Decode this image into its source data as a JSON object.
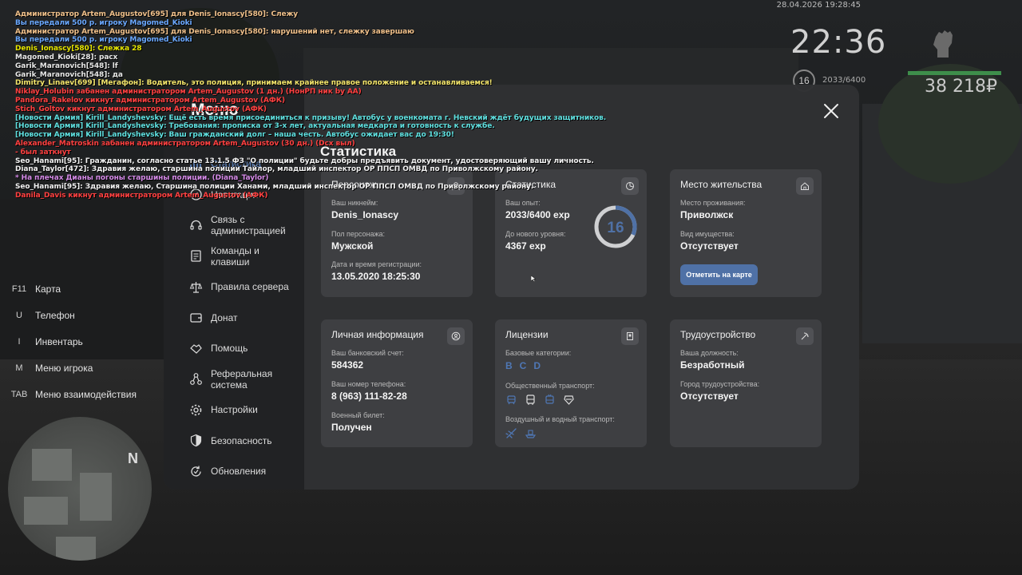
{
  "hud": {
    "datetime": "28.04.2026 19:28:45",
    "time": "22:36",
    "level": "16",
    "exp": "2033/6400",
    "money": "38 218₽"
  },
  "chat": [
    {
      "text": "Администратор Artem_Augustov[695] для Denis_Ionascy[580]: Слежу",
      "color": "#f0c08a"
    },
    {
      "text": "Вы передали 500 р. игроку Magomed_Kioki",
      "color": "#6aa8ff"
    },
    {
      "text": "Администратор Artem_Augustov[695] для Denis_Ionascy[580]: нарушений нет, слежку завершаю",
      "color": "#f0c08a"
    },
    {
      "text": "Вы передали 500 р. игроку Magomed_Kioki",
      "color": "#6aa8ff"
    },
    {
      "text": "Denis_Ionascy[580]: Слежка 28",
      "color": "#e6e600",
      "name": "Denis_Ionascy[580]",
      "nameColor": "#8fd67a"
    },
    {
      "text": "Magomed_Kioki[28]: расх",
      "color": "#e8e8e8"
    },
    {
      "text": "Garik_Maranovich[548]: lf",
      "color": "#e8e8e8"
    },
    {
      "text": "Garik_Maranovich[548]: да",
      "color": "#e8e8e8"
    },
    {
      "text": "Dimitry_Linaev[699] [Мегафон]: Водитель, это полиция, принимаем крайнее правое положение и останавливаемся!",
      "color": "#f2e46a"
    },
    {
      "text": "Niklay_Holubin забанен администратором Artem_Augustov (1 дн.) (НонРП ник by AA)",
      "color": "#ff4040"
    },
    {
      "text": "Pandora_Rakelov кикнут администратором Artem_Augustov (АФК)",
      "color": "#ff4040"
    },
    {
      "text": "Stich_Goltov кикнут администратором Artem_Augustov (АФК)",
      "color": "#ff4040"
    },
    {
      "text": "[Новости Армия] Kirill_Landyshevsky: Ещё есть время присоединиться к призыву! Автобус у военкомата г. Невский ждёт будущих защитников.",
      "color": "#5fe0e0"
    },
    {
      "text": "[Новости Армия] Kirill_Landyshevsky: Требования: прописка от 3-х лет, актуальная медкарта и готовность к службе.",
      "color": "#5fe0e0"
    },
    {
      "text": "[Новости Армия] Kirill_Landyshevsky: Ваш гражданский долг – наша честь. Автобус ожидает вас до 19:30!",
      "color": "#5fe0e0"
    },
    {
      "text": "Alexander_Matroskin забанен администратором Artem_Augustov (30 дн.) (Dcx выл)",
      "color": "#ff4040"
    },
    {
      "text": " - был заткнут",
      "color": "#ff4040"
    },
    {
      "text": "Seo_Hanami[95]: Гражданин, согласно статье 13.1.5 ФЗ \"О полиции\" будьте добры предъявить документ, удостоверяющий вашу личность.",
      "color": "#f2f2f2",
      "name": "Seo_Hanami[95]",
      "nameColor": "#6aa8ff"
    },
    {
      "text": "Diana_Taylor[472]: Здравия желаю, старшина полиции Тайлор, младший инспектор ОР ППСП ОМВД по Приволжскому району.",
      "color": "#f2f2f2",
      "name": "Diana_Taylor[472]",
      "nameColor": "#6aa8ff"
    },
    {
      "text": "* На плечах Дианы погоны старшины полиции. (Diana_Taylor)",
      "color": "#d58ae8"
    },
    {
      "text": "Seo_Hanami[95]: Здравия желаю, Старшина полиции Ханами, младший инспектор ОР ППСП ОМВД по Приволжскому району.",
      "color": "#f2f2f2",
      "name": "Seo_Hanami[95]",
      "nameColor": "#6aa8ff"
    },
    {
      "text": "Danila_Davis кикнут администратором Artem_Augustov (АФК)",
      "color": "#ff4040"
    }
  ],
  "keys": [
    {
      "key": "F11",
      "label": "Карта"
    },
    {
      "key": "U",
      "label": "Телефон"
    },
    {
      "key": "I",
      "label": "Инвентарь"
    },
    {
      "key": "M",
      "label": "Меню игрока"
    },
    {
      "key": "TAB",
      "label": "Меню взаимодействия"
    }
  ],
  "minimap": {
    "north": "N"
  },
  "menu": {
    "title": "Меню",
    "items": [
      {
        "label": "Статистика",
        "icon": "chart-icon",
        "active": true
      },
      {
        "label": "Навигация",
        "icon": "compass-icon"
      },
      {
        "label": "Связь с администрацией",
        "icon": "headset-icon"
      },
      {
        "label": "Команды и клавиши",
        "icon": "document-icon"
      },
      {
        "label": "Правила сервера",
        "icon": "scales-icon"
      },
      {
        "label": "Донат",
        "icon": "wallet-icon"
      },
      {
        "label": "Помощь",
        "icon": "handshake-icon"
      },
      {
        "label": "Реферальная система",
        "icon": "network-icon"
      },
      {
        "label": "Настройки",
        "icon": "gear-icon"
      },
      {
        "label": "Безопасность",
        "icon": "shield-icon"
      },
      {
        "label": "Обновления",
        "icon": "refresh-icon"
      }
    ]
  },
  "page": {
    "title": "Статистика"
  },
  "cards": {
    "character": {
      "title": "Персонаж",
      "nickname_label": "Ваш никнейм:",
      "nickname": "Denis_Ionascy",
      "gender_label": "Пол персонажа:",
      "gender": "Мужской",
      "reg_label": "Дата и время регистрации:",
      "reg": "13.05.2020 18:25:30"
    },
    "stats": {
      "title": "Статистика",
      "exp_label": "Ваш опыт:",
      "exp": "2033/6400 exp",
      "next_label": "До нового уровня:",
      "next": "4367 exp",
      "level": "16",
      "progress": 0.3177,
      "ring_color": "#4f71a6"
    },
    "residence": {
      "title": "Место жительства",
      "place_label": "Место проживания:",
      "place": "Приволжск",
      "property_label": "Вид имущества:",
      "property": "Отсутствует",
      "button": "Отметить на карте"
    },
    "personal": {
      "title": "Личная информация",
      "bank_label": "Ваш банковский счет:",
      "bank": "584362",
      "phone_label": "Ваш номер телефона:",
      "phone": "8 (963) 111-82-28",
      "military_label": "Военный билет:",
      "military": "Получен"
    },
    "licenses": {
      "title": "Лицензии",
      "basic_label": "Базовые категории:",
      "categories": [
        "B",
        "C",
        "D"
      ],
      "public_label": "Общественный транспорт:",
      "air_label": "Воздушный и водный транспорт:"
    },
    "job": {
      "title": "Трудоустройство",
      "position_label": "Ваша должность:",
      "position": "Безработный",
      "city_label": "Город трудоустройства:",
      "city": "Отсутствует"
    }
  }
}
